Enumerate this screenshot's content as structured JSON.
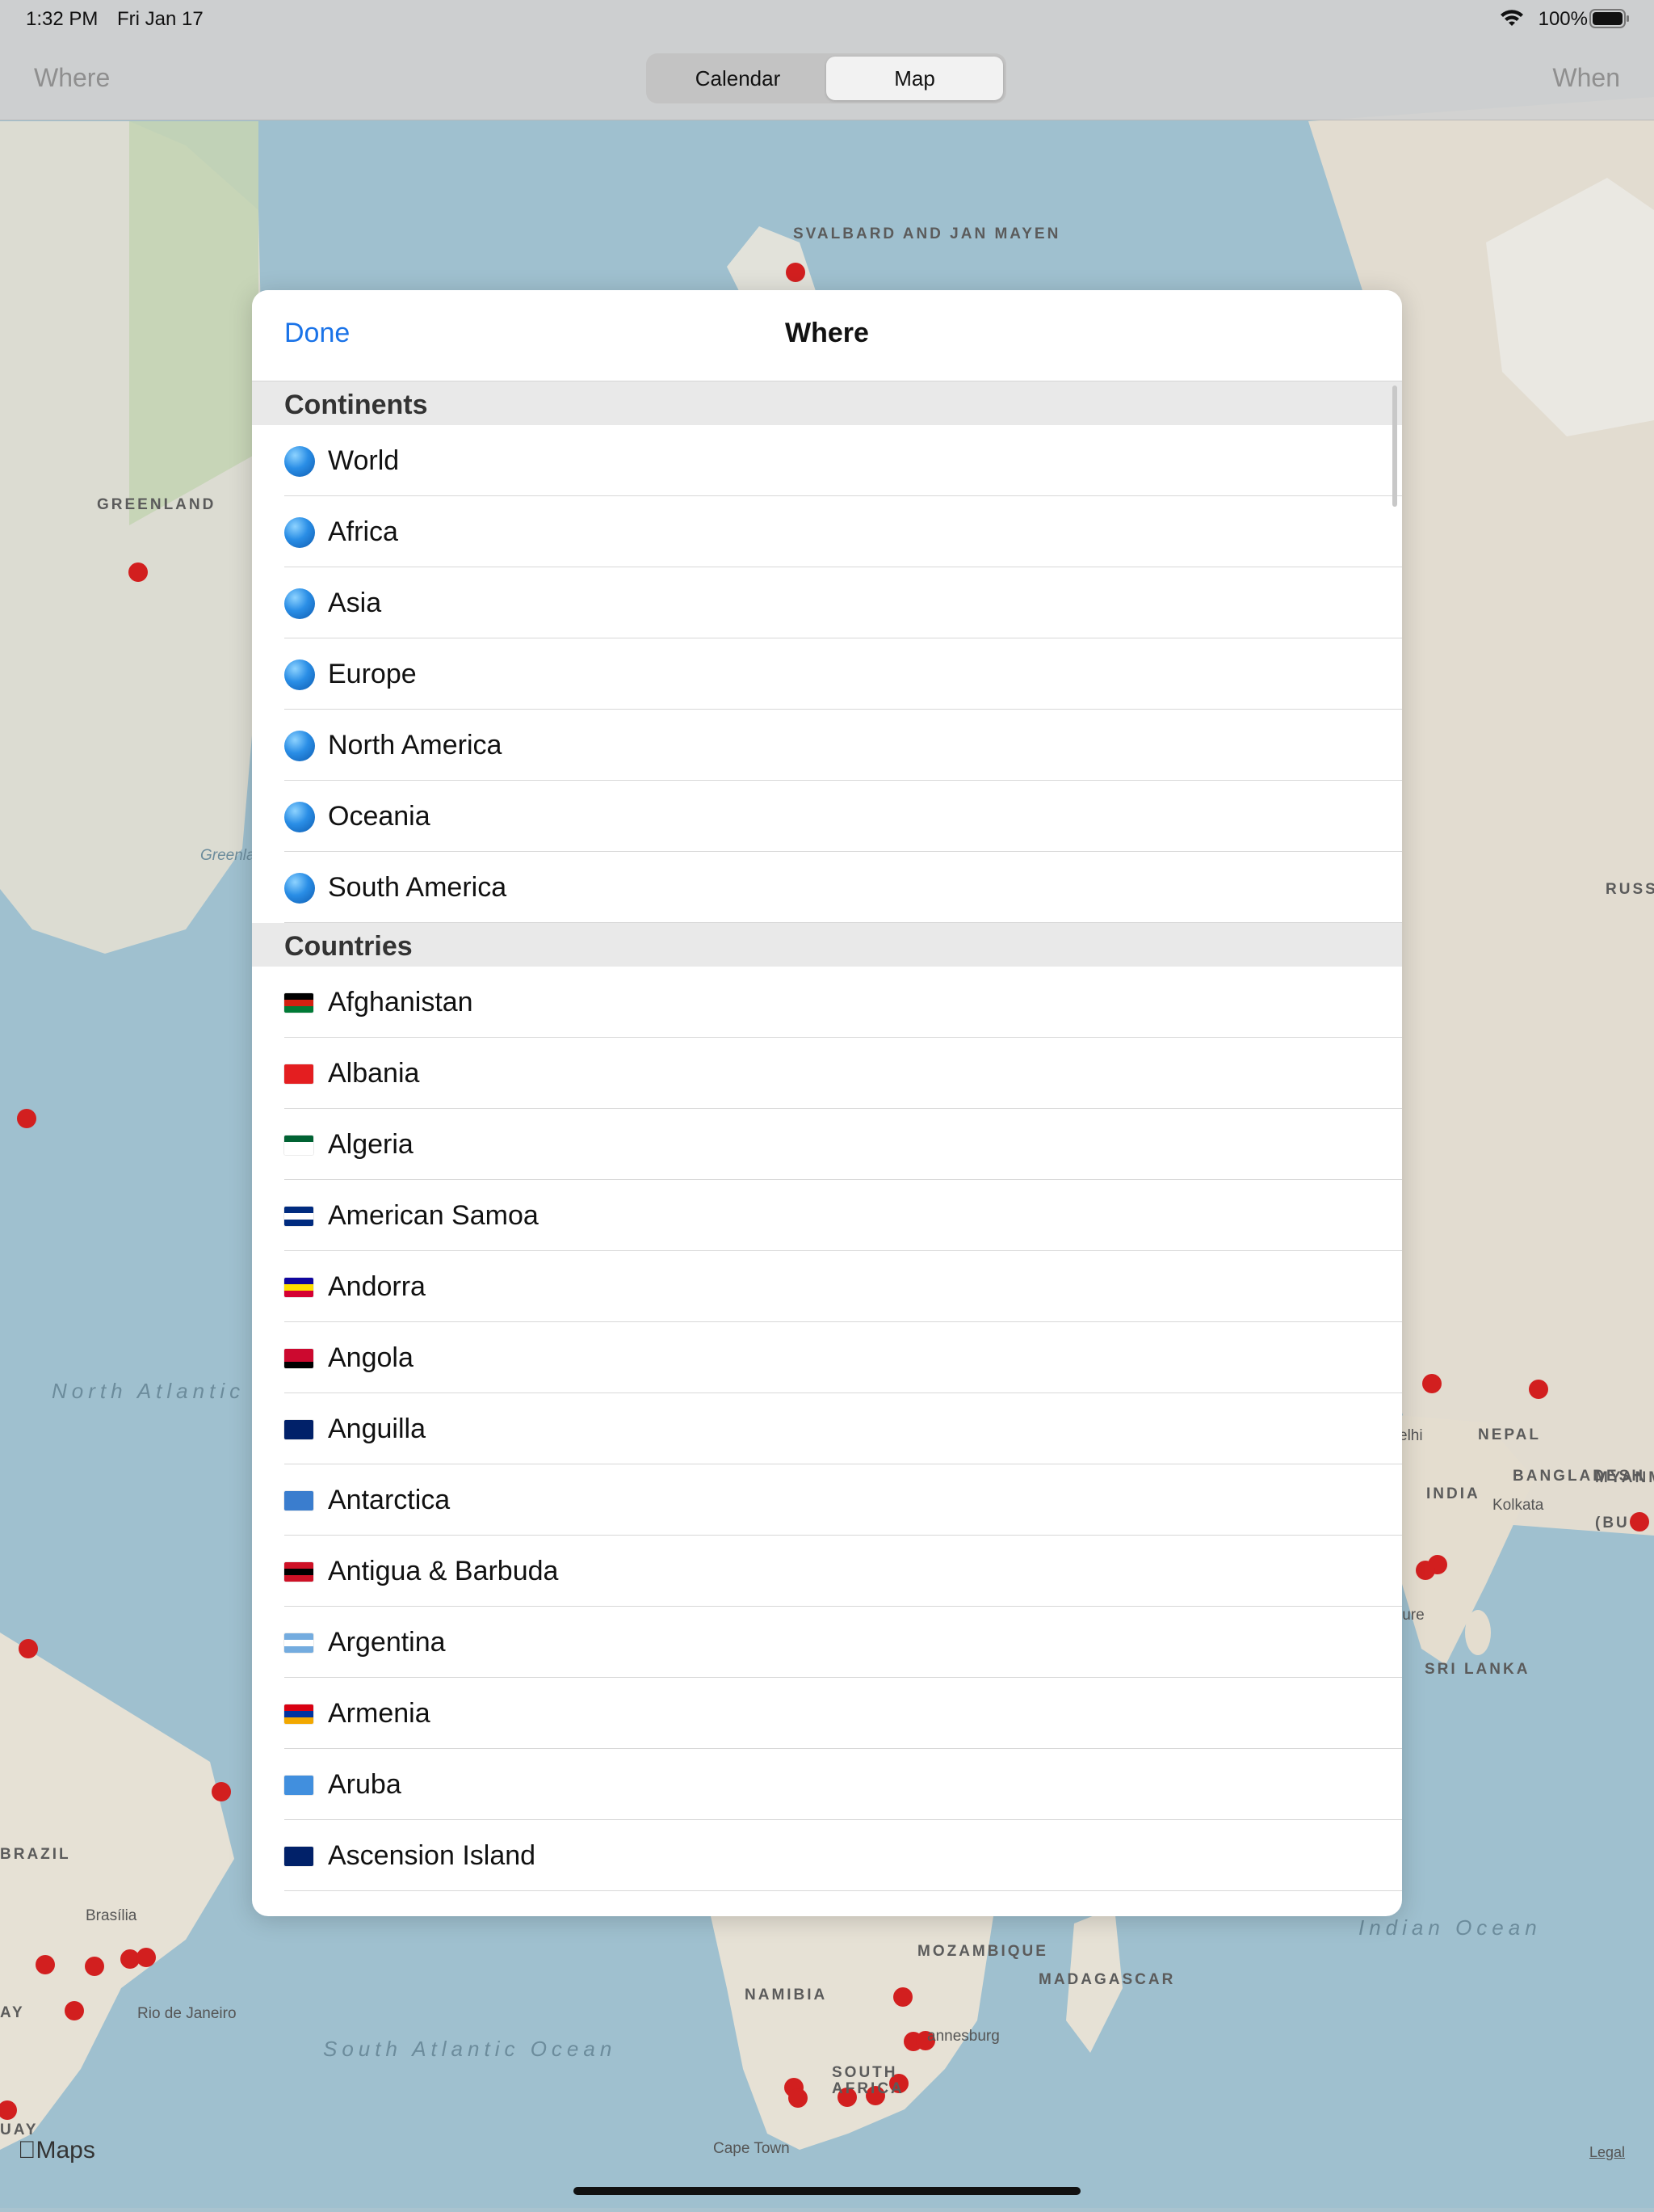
{
  "status_bar": {
    "time": "1:32 PM",
    "date": "Fri Jan 17",
    "battery": "100%"
  },
  "nav": {
    "where": "Where",
    "when": "When",
    "segments": [
      "Calendar",
      "Map"
    ],
    "selected_segment": "Map"
  },
  "map": {
    "labels": {
      "svalbard": "SVALBARD AND JAN MAYEN",
      "greenland": "GREENLAND",
      "greenland_sea": "Greenland Sea",
      "russia": "RUSS",
      "north_atlantic": "North Atlantic Ocean",
      "brazil": "BRAZIL",
      "brasilia": "Brasília",
      "rio": "Rio de Janeiro",
      "south_atlantic": "South Atlantic Ocean",
      "uruguay": "UAY",
      "nepal": "NEPAL",
      "bangladesh": "BANGLADESH",
      "india": "INDIA",
      "kolkata": "Kolkata",
      "delhi": "elhi",
      "sri_lanka": "SRI LANKA",
      "myanmar": "MYANM",
      "myanmar2": "(BU",
      "indian_ocean": "Indian Ocean",
      "mozambique": "MOZAMBIQUE",
      "madagascar": "MADAGASCAR",
      "namibia": "NAMIBIA",
      "south_africa": "SOUTH AFRICA",
      "johannesburg": "annesburg",
      "cape_town": "Cape Town",
      "ay": "AY",
      "lure": "lure"
    },
    "maps_logo": "Maps",
    "legal": "Legal"
  },
  "modal": {
    "title": "Where",
    "done_label": "Done",
    "sections": [
      {
        "header": "Continents",
        "items": [
          {
            "name": "World",
            "icon": "globe-icon"
          },
          {
            "name": "Africa",
            "icon": "globe-icon"
          },
          {
            "name": "Asia",
            "icon": "globe-icon"
          },
          {
            "name": "Europe",
            "icon": "globe-icon"
          },
          {
            "name": "North America",
            "icon": "globe-icon"
          },
          {
            "name": "Oceania",
            "icon": "globe-icon"
          },
          {
            "name": "South America",
            "icon": "globe-icon"
          }
        ]
      },
      {
        "header": "Countries",
        "items": [
          {
            "name": "Afghanistan",
            "icon": "flag-icon",
            "colors": [
              "#000000",
              "#d32011",
              "#007a36"
            ]
          },
          {
            "name": "Albania",
            "icon": "flag-icon",
            "colors": [
              "#e41e20",
              "#e41e20",
              "#e41e20"
            ]
          },
          {
            "name": "Algeria",
            "icon": "flag-icon",
            "colors": [
              "#006233",
              "#ffffff",
              "#ffffff"
            ]
          },
          {
            "name": "American Samoa",
            "icon": "flag-icon",
            "colors": [
              "#002b7f",
              "#ffffff",
              "#002b7f"
            ]
          },
          {
            "name": "Andorra",
            "icon": "flag-icon",
            "colors": [
              "#10069f",
              "#fedf00",
              "#d50032"
            ]
          },
          {
            "name": "Angola",
            "icon": "flag-icon",
            "colors": [
              "#cc092f",
              "#cc092f",
              "#000000"
            ]
          },
          {
            "name": "Anguilla",
            "icon": "flag-icon",
            "colors": [
              "#012169",
              "#012169",
              "#012169"
            ]
          },
          {
            "name": "Antarctica",
            "icon": "flag-icon",
            "colors": [
              "#3a7dce",
              "#3a7dce",
              "#3a7dce"
            ]
          },
          {
            "name": "Antigua & Barbuda",
            "icon": "flag-icon",
            "colors": [
              "#ce1126",
              "#000000",
              "#ce1126"
            ]
          },
          {
            "name": "Argentina",
            "icon": "flag-icon",
            "colors": [
              "#74acdf",
              "#ffffff",
              "#74acdf"
            ]
          },
          {
            "name": "Armenia",
            "icon": "flag-icon",
            "colors": [
              "#d90012",
              "#0033a0",
              "#f2a800"
            ]
          },
          {
            "name": "Aruba",
            "icon": "flag-icon",
            "colors": [
              "#418fde",
              "#418fde",
              "#418fde"
            ]
          },
          {
            "name": "Ascension Island",
            "icon": "flag-icon",
            "colors": [
              "#012169",
              "#012169",
              "#012169"
            ]
          }
        ]
      }
    ]
  }
}
